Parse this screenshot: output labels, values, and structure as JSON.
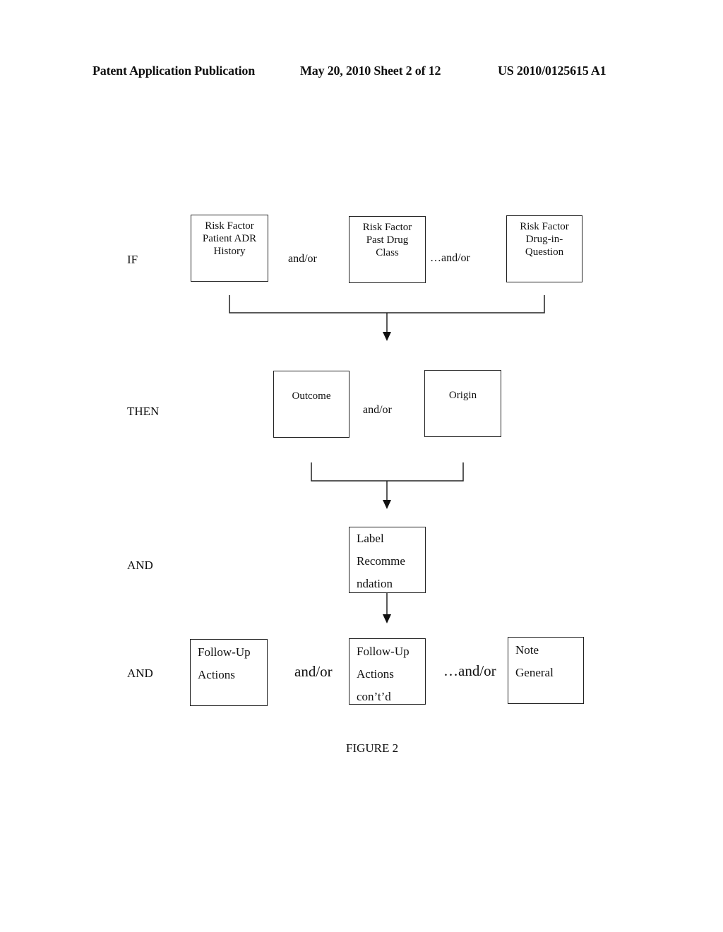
{
  "header": {
    "left": "Patent Application Publication",
    "center": "May 20, 2010  Sheet 2 of 12",
    "right": "US 2010/0125615 A1"
  },
  "rows": {
    "if": {
      "label": "IF",
      "boxes": [
        {
          "lines": [
            "Risk Factor",
            "Patient ADR",
            "History"
          ]
        },
        {
          "lines": [
            "Risk Factor",
            "Past Drug",
            "Class"
          ]
        },
        {
          "lines": [
            "Risk Factor",
            "Drug-in-",
            "Question"
          ]
        }
      ],
      "connectors": [
        "and/or",
        "…and/or"
      ]
    },
    "then": {
      "label": "THEN",
      "boxes": [
        {
          "lines": [
            "Outcome"
          ]
        },
        {
          "lines": [
            "Origin"
          ]
        }
      ],
      "connectors": [
        "and/or"
      ]
    },
    "and1": {
      "label": "AND",
      "boxes": [
        {
          "lines": [
            "Label",
            "Recomme",
            "ndation"
          ]
        }
      ]
    },
    "and2": {
      "label": "AND",
      "boxes": [
        {
          "lines": [
            "Follow-Up",
            "Actions"
          ]
        },
        {
          "lines": [
            "Follow-Up",
            "Actions",
            "con’t’d"
          ]
        },
        {
          "lines": [
            "Note",
            "General"
          ]
        }
      ],
      "connectors": [
        "and/or",
        "…and/or"
      ]
    }
  },
  "caption": "FIGURE 2"
}
